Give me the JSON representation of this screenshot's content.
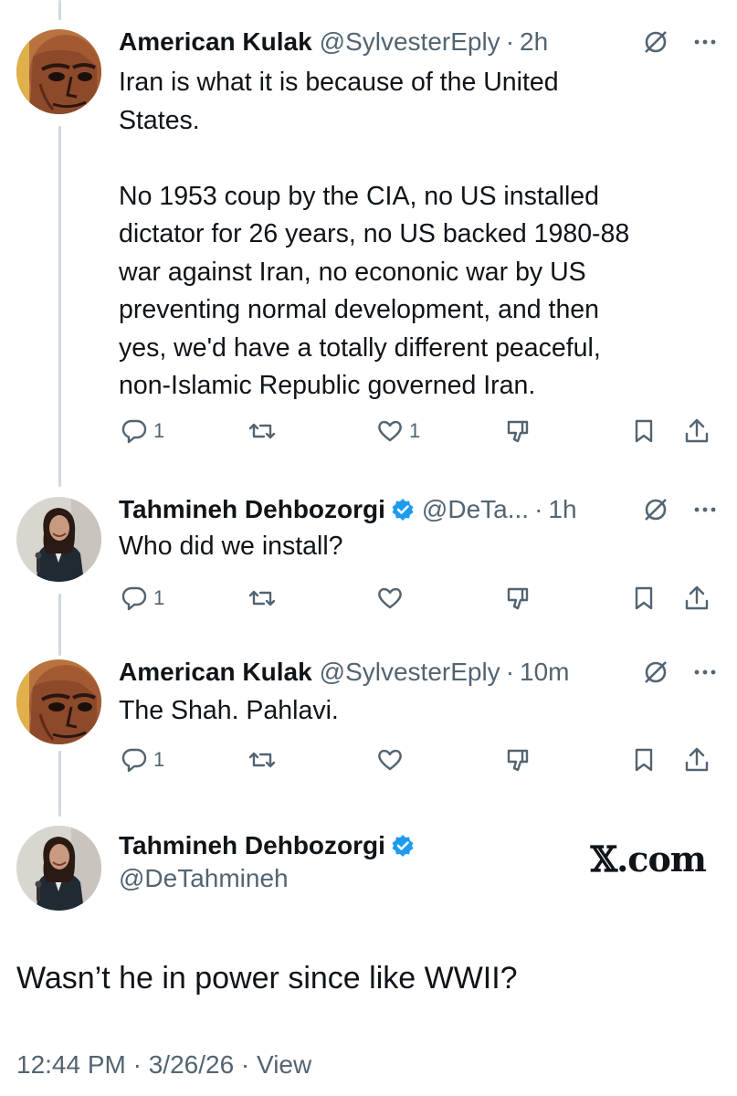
{
  "tweets": [
    {
      "author": "American Kulak",
      "handle": "@SylvesterEply",
      "time": "2h",
      "text": "Iran is what it is because of the United\nStates.\n\nNo 1953 coup by the CIA, no US installed\ndictator for 26 years, no US backed 1980-88\nwar against Iran, no econonic war by US\npreventing normal development, and then\nyes, we'd have a totally different peaceful,\nnon-Islamic Republic governed Iran.",
      "replies": "1",
      "likes": "1",
      "avatar_icon": "icon-portrait"
    },
    {
      "author": "Tahmineh Dehbozorgi",
      "handle": "@DeTa...",
      "time": "1h",
      "text": "Who did we install?",
      "replies": "1",
      "likes": "",
      "verified": true,
      "avatar_icon": "speaker-photo"
    },
    {
      "author": "American Kulak",
      "handle": "@SylvesterEply",
      "time": "10m",
      "text": "The Shah. Pahlavi.",
      "replies": "1",
      "likes": "",
      "avatar_icon": "icon-portrait"
    }
  ],
  "focal": {
    "author": "Tahmineh Dehbozorgi",
    "handle": "@DeTahmineh",
    "verified": true,
    "watermark": "𝕏.com",
    "text": "Wasn’t he in power since like WWII?",
    "timestamp": "12:44 PM · 3/26/26 · View"
  },
  "colors": {
    "text": "#0f1419",
    "secondary": "#536471",
    "verified": "#1d9bf0",
    "thread_line": "#cfd9de"
  }
}
